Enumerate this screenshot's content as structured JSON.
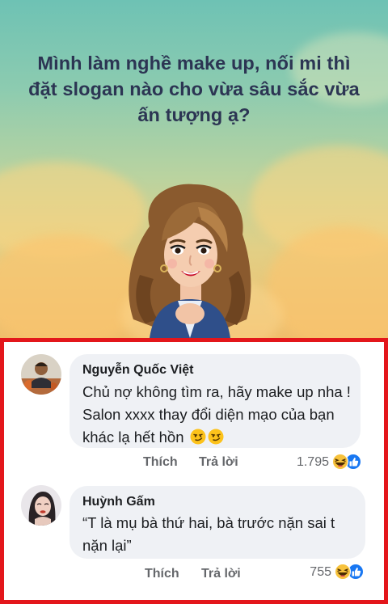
{
  "post": {
    "question": "Mình làm nghề make up, nối mi thì đặt slogan nào cho vừa sâu sắc vừa ấn tượng ạ?",
    "background_colors": [
      "#6ec2b4",
      "#f0be6c"
    ]
  },
  "comments": [
    {
      "author": "Nguyễn Quốc Việt",
      "text": "Chủ nợ không tìm ra, hãy make up nha !  Salon xxxx thay đổi diện mạo của bạn khác lạ hết hồn",
      "emojis": [
        "smirk-emoji",
        "smirk-emoji"
      ],
      "like_label": "Thích",
      "reply_label": "Trả lời",
      "reaction_count": "1.795",
      "reaction_icons": [
        "haha-icon",
        "like-icon"
      ]
    },
    {
      "author": "Huỳnh Gấm",
      "text": "“T là mụ bà thứ hai, bà trước nặn sai t nặn lại”",
      "like_label": "Thích",
      "reply_label": "Trả lời",
      "reaction_count": "755",
      "reaction_icons": [
        "haha-icon",
        "like-icon"
      ]
    }
  ],
  "colors": {
    "highlight_frame": "#e3161b",
    "comment_bubble": "#eff1f5",
    "like_blue": "#1877f2",
    "haha_yellow": "#f7c23c"
  }
}
